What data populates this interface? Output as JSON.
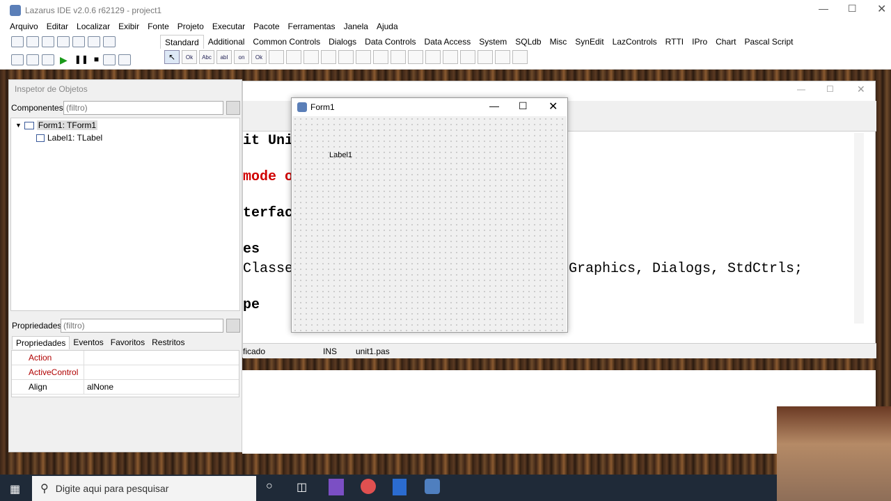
{
  "window": {
    "title": "Lazarus IDE v2.0.6 r62129 - project1"
  },
  "menu": [
    "Arquivo",
    "Editar",
    "Localizar",
    "Exibir",
    "Fonte",
    "Projeto",
    "Executar",
    "Pacote",
    "Ferramentas",
    "Janela",
    "Ajuda"
  ],
  "palette_tabs": [
    "Standard",
    "Additional",
    "Common Controls",
    "Dialogs",
    "Data Controls",
    "Data Access",
    "System",
    "SQLdb",
    "Misc",
    "SynEdit",
    "LazControls",
    "RTTI",
    "IPro",
    "Chart",
    "Pascal Script"
  ],
  "palette_items": [
    "Ok",
    "Abc",
    "abI",
    "on"
  ],
  "inspector": {
    "title": "Inspetor de Objetos",
    "components_label": "Componentes",
    "filter_placeholder": "(filtro)",
    "tree": [
      "Form1: TForm1",
      "Label1: TLabel"
    ],
    "props_label": "Propriedades",
    "props_filter_placeholder": "(filtro)",
    "tabs": [
      "Propriedades",
      "Eventos",
      "Favoritos",
      "Restritos"
    ],
    "rows": [
      {
        "name": "Action",
        "value": "",
        "red": true
      },
      {
        "name": "ActiveControl",
        "value": "",
        "red": true
      },
      {
        "name": "Align",
        "value": "alNone",
        "red": false
      }
    ]
  },
  "source": {
    "lines": [
      {
        "text": "it Uni",
        "color": "#000",
        "bold": true
      },
      {
        "text": "mode o",
        "color": "#d00000",
        "bold": true
      },
      {
        "text": "terfac",
        "color": "#000",
        "bold": true
      },
      {
        "text": "es",
        "color": "#000",
        "bold": true
      },
      {
        "text": "Classe",
        "color": "#000",
        "bold": false
      },
      {
        "text": "pe",
        "color": "#000",
        "bold": true
      }
    ],
    "right_line": "Graphics, Dialogs, StdCtrls;"
  },
  "status": {
    "modified": "ficado",
    "ins": "INS",
    "file": "unit1.pas"
  },
  "form": {
    "title": "Form1",
    "label": "Label1"
  },
  "taskbar": {
    "search": "Digite aqui para pesquisar"
  }
}
